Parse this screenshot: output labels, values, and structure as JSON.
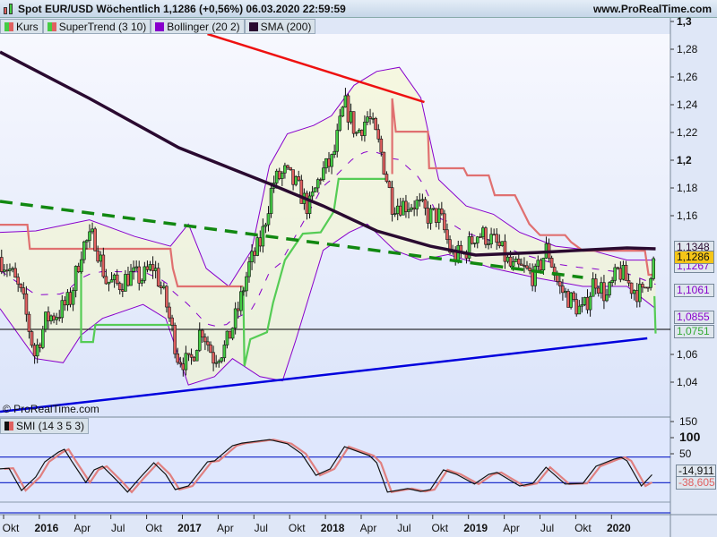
{
  "header": {
    "title": "Spot EUR/USD Wöchentlich 1,1286 (+0,56%) 06.03.2020 22:59:59",
    "website": "www.ProRealTime.com"
  },
  "legend": [
    {
      "label": "Kurs",
      "colors": [
        "#44cc44",
        "#e06060"
      ]
    },
    {
      "label": "SuperTrend (3 10)",
      "colors": [
        "#44cc44",
        "#e06060"
      ]
    },
    {
      "label": "Bollinger (20 2)",
      "colors": [
        "#8800cc",
        "#8800cc"
      ]
    },
    {
      "label": "SMA (200)",
      "colors": [
        "#2a0a30",
        "#2a0a30"
      ]
    }
  ],
  "copyright": "© ProRealTime.com",
  "smi_legend": {
    "label": "SMI (14 3 5 3)"
  },
  "badges": {
    "sma": "1,1348",
    "price": "1,1286",
    "boll_mid": "1,1267",
    "boll_upper": "1,1061",
    "boll_lower": "1,0855",
    "supertrend": "1,0751",
    "smi": "-14,911",
    "smi_signal": "-38,605"
  },
  "colors": {
    "up": "#44cc44",
    "down": "#e06060",
    "bollinger": "#8800cc",
    "sma": "#2a0a30",
    "supertrend_up": "#55cc55",
    "supertrend_down": "#e07070",
    "trend_blue": "#0000dd",
    "trend_red": "#ee1111",
    "trend_green": "#118811"
  },
  "chart_data": {
    "type": "candlestick",
    "title": "Spot EUR/USD Wöchentlich",
    "ylim": [
      1.03,
      1.3
    ],
    "price_ticks": [
      {
        "v": 1.3,
        "label": "1,3",
        "bold": true
      },
      {
        "v": 1.28,
        "label": "1,28"
      },
      {
        "v": 1.26,
        "label": "1,26"
      },
      {
        "v": 1.24,
        "label": "1,24"
      },
      {
        "v": 1.22,
        "label": "1,22"
      },
      {
        "v": 1.2,
        "label": "1,2",
        "bold": true
      },
      {
        "v": 1.18,
        "label": "1,18"
      },
      {
        "v": 1.16,
        "label": "1,16"
      },
      {
        "v": 1.06,
        "label": "1,06"
      },
      {
        "v": 1.04,
        "label": "1,04"
      }
    ],
    "time_ticks": [
      {
        "m": 0,
        "label": "Okt"
      },
      {
        "m": 3,
        "label": "2016",
        "bold": true
      },
      {
        "m": 6,
        "label": "Apr"
      },
      {
        "m": 9,
        "label": "Jul"
      },
      {
        "m": 12,
        "label": "Okt"
      },
      {
        "m": 15,
        "label": "2017",
        "bold": true
      },
      {
        "m": 18,
        "label": "Apr"
      },
      {
        "m": 21,
        "label": "Jul"
      },
      {
        "m": 24,
        "label": "Okt"
      },
      {
        "m": 27,
        "label": "2018",
        "bold": true
      },
      {
        "m": 30,
        "label": "Apr"
      },
      {
        "m": 33,
        "label": "Jul"
      },
      {
        "m": 36,
        "label": "Okt"
      },
      {
        "m": 39,
        "label": "2019",
        "bold": true
      },
      {
        "m": 42,
        "label": "Apr"
      },
      {
        "m": 45,
        "label": "Jul"
      },
      {
        "m": 48,
        "label": "Okt"
      },
      {
        "m": 51,
        "label": "2020",
        "bold": true
      }
    ],
    "monthly_close_start": -1,
    "monthly_close": [
      1.13,
      1.12,
      1.1,
      1.06,
      1.086,
      1.09,
      1.1,
      1.138,
      1.145,
      1.113,
      1.11,
      1.117,
      1.115,
      1.124,
      1.098,
      1.059,
      1.052,
      1.08,
      1.058,
      1.065,
      1.09,
      1.124,
      1.142,
      1.184,
      1.191,
      1.181,
      1.165,
      1.19,
      1.2,
      1.241,
      1.219,
      1.232,
      1.208,
      1.169,
      1.168,
      1.169,
      1.16,
      1.16,
      1.131,
      1.132,
      1.147,
      1.145,
      1.137,
      1.122,
      1.121,
      1.116,
      1.137,
      1.108,
      1.099,
      1.09,
      1.115,
      1.101,
      1.121,
      1.109,
      1.103,
      1.1286
    ],
    "sma200": [
      [
        -0.9,
        1.278
      ],
      [
        6.6,
        1.2445
      ],
      [
        14.1,
        1.209
      ],
      [
        21.7,
        1.183
      ],
      [
        26.2,
        1.167
      ],
      [
        30.7,
        1.149
      ],
      [
        35.2,
        1.138
      ],
      [
        39,
        1.1316
      ],
      [
        44.2,
        1.1335
      ],
      [
        51.7,
        1.1368
      ],
      [
        54.1,
        1.1361
      ]
    ],
    "bollinger_upper": [
      [
        -0.9,
        1.148
      ],
      [
        2.1,
        1.149
      ],
      [
        6.6,
        1.157
      ],
      [
        10.4,
        1.145
      ],
      [
        13.4,
        1.138
      ],
      [
        14.9,
        1.154
      ],
      [
        16.4,
        1.122
      ],
      [
        18.3,
        1.109
      ],
      [
        20.2,
        1.135
      ],
      [
        21.7,
        1.196
      ],
      [
        23.2,
        1.219
      ],
      [
        25.4,
        1.225
      ],
      [
        26.9,
        1.232
      ],
      [
        28.8,
        1.254
      ],
      [
        30.7,
        1.264
      ],
      [
        32.6,
        1.267
      ],
      [
        34.4,
        1.245
      ],
      [
        35.9,
        1.186
      ],
      [
        38.2,
        1.167
      ],
      [
        40.5,
        1.161
      ],
      [
        42.7,
        1.148
      ],
      [
        45.7,
        1.138
      ],
      [
        48.7,
        1.135
      ],
      [
        51.7,
        1.128
      ],
      [
        54.1,
        1.128
      ]
    ],
    "bollinger_lower": [
      [
        -0.9,
        1.093
      ],
      [
        2.1,
        1.057
      ],
      [
        4.4,
        1.054
      ],
      [
        5.9,
        1.074
      ],
      [
        7.7,
        1.086
      ],
      [
        11.1,
        1.096
      ],
      [
        13.0,
        1.086
      ],
      [
        14.9,
        1.038
      ],
      [
        17.1,
        1.044
      ],
      [
        18.6,
        1.057
      ],
      [
        20.9,
        1.044
      ],
      [
        22.8,
        1.041
      ],
      [
        23.9,
        1.07
      ],
      [
        26.2,
        1.135
      ],
      [
        28.4,
        1.148
      ],
      [
        29.9,
        1.154
      ],
      [
        32.2,
        1.135
      ],
      [
        34.4,
        1.128
      ],
      [
        36.7,
        1.132
      ],
      [
        40.5,
        1.122
      ],
      [
        44.2,
        1.115
      ],
      [
        48.0,
        1.109
      ],
      [
        51.7,
        1.109
      ],
      [
        54.1,
        1.093
      ]
    ],
    "supertrend": [
      {
        "dir": "down",
        "points": [
          [
            -0.9,
            1.1535
          ],
          [
            1.4,
            1.1535
          ],
          [
            1.6,
            1.1361
          ],
          [
            13.4,
            1.1361
          ],
          [
            13.6,
            1.122
          ],
          [
            14.0,
            1.109
          ],
          [
            19.5,
            1.109
          ]
        ]
      },
      {
        "dir": "up",
        "points": [
          [
            5.9,
            1.1245
          ],
          [
            5.9,
            1.069
          ],
          [
            6.9,
            1.069
          ],
          [
            7.1,
            1.0813
          ],
          [
            13.5,
            1.0813
          ]
        ]
      },
      {
        "dir": "up",
        "points": [
          [
            19.5,
            1.109
          ],
          [
            19.6,
            1.0516
          ],
          [
            20.1,
            1.071
          ],
          [
            21.5,
            1.076
          ],
          [
            22.0,
            1.097
          ],
          [
            23.0,
            1.128
          ],
          [
            24.5,
            1.147
          ],
          [
            26.0,
            1.148
          ],
          [
            27.1,
            1.163
          ],
          [
            27.5,
            1.1865
          ],
          [
            31.6,
            1.1865
          ]
        ]
      },
      {
        "dir": "down",
        "points": [
          [
            32.0,
            1.19
          ],
          [
            32.0,
            1.2445
          ],
          [
            32.3,
            1.2206
          ],
          [
            35.0,
            1.2206
          ],
          [
            35.1,
            1.1942
          ],
          [
            38.0,
            1.1942
          ],
          [
            38.3,
            1.189
          ],
          [
            40.1,
            1.189
          ],
          [
            40.6,
            1.1748
          ],
          [
            42.3,
            1.1748
          ],
          [
            43.5,
            1.154
          ],
          [
            44.4,
            1.146
          ],
          [
            46.5,
            1.146
          ],
          [
            47.0,
            1.141
          ],
          [
            48.0,
            1.1348
          ],
          [
            53.2,
            1.1348
          ],
          [
            53.5,
            1.1174
          ],
          [
            54.0,
            1.1174
          ]
        ]
      },
      {
        "dir": "up",
        "points": [
          [
            54.0,
            1.102
          ],
          [
            54.1,
            1.0751
          ]
        ]
      }
    ],
    "trendlines": [
      {
        "name": "trend-red",
        "color": "trend_red",
        "points": [
          [
            16.5,
            1.291
          ],
          [
            34.7,
            1.2419
          ]
        ]
      },
      {
        "name": "trend-green-dashed",
        "color": "trend_green",
        "dashed": true,
        "points": [
          [
            -0.9,
            1.1703
          ],
          [
            48.0,
            1.1155
          ]
        ]
      },
      {
        "name": "trend-blue",
        "color": "trend_blue",
        "points": [
          [
            -0.9,
            1.0187
          ],
          [
            53.4,
            1.0716
          ]
        ]
      }
    ],
    "hline": 1.0781,
    "smi": {
      "ticks": [
        {
          "v": 150,
          "label": "150"
        },
        {
          "v": 100,
          "label": "100",
          "bold": true
        },
        {
          "v": 50,
          "label": "50"
        }
      ],
      "levels": [
        40,
        -40
      ],
      "values": [
        [
          -0.9,
          3
        ],
        [
          -0.15,
          5
        ],
        [
          0.9,
          -64
        ],
        [
          2.1,
          -22
        ],
        [
          2.86,
          25
        ],
        [
          4.0,
          55
        ],
        [
          4.5,
          64
        ],
        [
          5.1,
          28
        ],
        [
          6.3,
          -39
        ],
        [
          7.0,
          0
        ],
        [
          7.7,
          11
        ],
        [
          8.9,
          -33
        ],
        [
          9.8,
          -69
        ],
        [
          10.75,
          -28
        ],
        [
          12.0,
          22
        ],
        [
          13.0,
          -14
        ],
        [
          13.8,
          -61
        ],
        [
          14.9,
          -50
        ],
        [
          16.5,
          25
        ],
        [
          17.1,
          28
        ],
        [
          18.6,
          75
        ],
        [
          19.4,
          83
        ],
        [
          21.7,
          94
        ],
        [
          23.2,
          81
        ],
        [
          24.4,
          50
        ],
        [
          25.6,
          -17
        ],
        [
          26.8,
          3
        ],
        [
          28.0,
          72
        ],
        [
          30.1,
          44
        ],
        [
          30.7,
          22
        ],
        [
          31.6,
          -69
        ],
        [
          33.3,
          -58
        ],
        [
          34.4,
          -67
        ],
        [
          35.2,
          -61
        ],
        [
          36.3,
          0
        ],
        [
          37.4,
          -14
        ],
        [
          38.9,
          -44
        ],
        [
          40.1,
          -14
        ],
        [
          40.8,
          -8
        ],
        [
          42.7,
          -50
        ],
        [
          43.8,
          -42
        ],
        [
          44.9,
          8
        ],
        [
          46.5,
          -44
        ],
        [
          48.0,
          -42
        ],
        [
          49.1,
          11
        ],
        [
          50.6,
          33
        ],
        [
          51.2,
          39
        ],
        [
          51.7,
          28
        ],
        [
          52.9,
          -50
        ],
        [
          53.8,
          -14.9
        ]
      ]
    }
  }
}
